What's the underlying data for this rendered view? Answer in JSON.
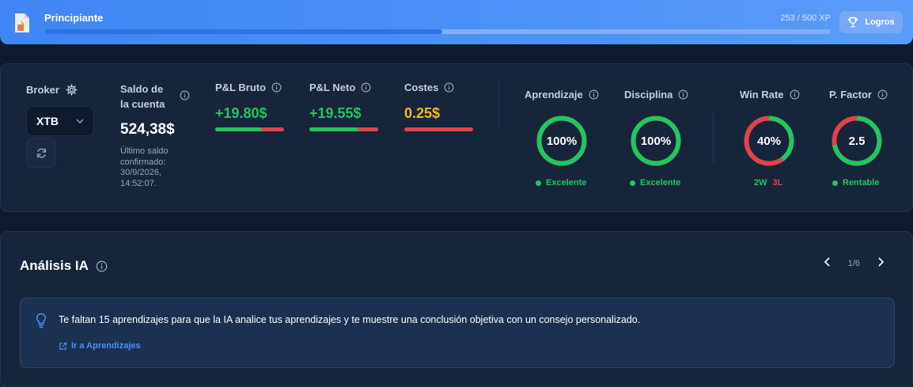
{
  "xp": {
    "level": "Principiante",
    "current": 253,
    "max": 500,
    "count_text": "253 / 500 XP",
    "logros_label": "Logros"
  },
  "stats": {
    "broker": {
      "label": "Broker",
      "selected": "XTB"
    },
    "balance": {
      "label_line1": "Saldo de",
      "label_line2": "la cuenta",
      "value": "524,38$",
      "note_line1": "Último saldo",
      "note_line2": "confirmado:",
      "note_line3": "30/9/2026,",
      "note_line4": "14:52:07."
    },
    "pl_bruto": {
      "label": "P&L Bruto",
      "value": "+19.80$",
      "green_fraction": 0.67,
      "color": "#22c55e"
    },
    "pl_neto": {
      "label": "P&L Neto",
      "value": "+19.55$",
      "green_fraction": 0.7,
      "color": "#22c55e"
    },
    "costes": {
      "label": "Costes",
      "value": "0.25$",
      "green_fraction": 0,
      "color": "#f5b820"
    },
    "gauges": {
      "aprendizaje": {
        "label": "Aprendizaje",
        "text": "100%",
        "green_fraction": 1.0,
        "status": "Excelente"
      },
      "disciplina": {
        "label": "Disciplina",
        "text": "100%",
        "green_fraction": 1.0,
        "status": "Excelente"
      },
      "win_rate": {
        "label": "Win Rate",
        "text": "40%",
        "green_fraction": 0.4,
        "wins": "2W",
        "losses": "3L"
      },
      "p_factor": {
        "label": "P. Factor",
        "text": "2.5",
        "green_fraction": 0.72,
        "status": "Rentable"
      }
    }
  },
  "ai": {
    "title": "Análisis IA",
    "page": "1/6",
    "message": "Te faltan 15 aprendizajes para que la IA analice tus aprendizajes y te muestre una conclusión objetiva con un consejo personalizado.",
    "link": "Ir a Aprendizajes"
  },
  "colors": {
    "green": "#22c55e",
    "red": "#e0444b",
    "accent_blue": "#3f86f3",
    "yellow": "#f5b820"
  }
}
